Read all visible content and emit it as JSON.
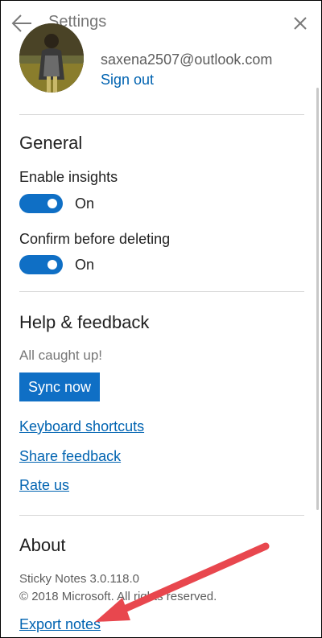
{
  "header": {
    "title": "Settings",
    "back_icon": "arrow-left-icon",
    "close_icon": "close-icon"
  },
  "account": {
    "email": "saxena2507@outlook.com",
    "signout_label": "Sign out"
  },
  "general": {
    "heading": "General",
    "items": [
      {
        "label": "Enable insights",
        "state": "On",
        "on": true
      },
      {
        "label": "Confirm before deleting",
        "state": "On",
        "on": true
      }
    ]
  },
  "help": {
    "heading": "Help & feedback",
    "status": "All caught up!",
    "sync_label": "Sync now",
    "links": [
      "Keyboard shortcuts",
      "Share feedback",
      "Rate us"
    ]
  },
  "about": {
    "heading": "About",
    "version": "Sticky Notes 3.0.118.0",
    "copyright": "© 2018 Microsoft. All rights reserved.",
    "export_label": "Export notes"
  },
  "colors": {
    "accent": "#0f6fc5",
    "link": "#0063b1",
    "annotation_arrow": "#e8474e"
  }
}
